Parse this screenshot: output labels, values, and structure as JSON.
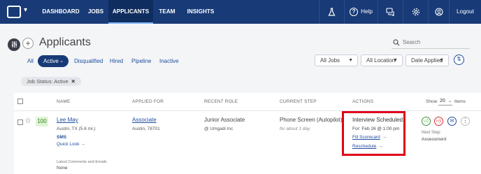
{
  "nav": {
    "items": [
      "DASHBOARD",
      "JOBS",
      "APPLICANTS",
      "TEAM",
      "INSIGHTS"
    ],
    "help_label": "Help",
    "logout_label": "Logout",
    "caret": "▾"
  },
  "page": {
    "title": "Applicants",
    "search_placeholder": "Search"
  },
  "tabs": [
    "All",
    "Active",
    "Disqualified",
    "Hired",
    "Pipeline",
    "Inactive"
  ],
  "filters": {
    "jobs": "All Jobs",
    "location": "All Location",
    "date": "Date Applied"
  },
  "chip": {
    "label": "Job Status: Active",
    "close": "✕"
  },
  "table": {
    "headers": {
      "name": "NAME",
      "applied_for": "APPLIED FOR",
      "recent_role": "RECENT ROLE",
      "current_step": "CURRENT STEP",
      "actions": "ACTIONS",
      "show": "Show",
      "show_value": "20",
      "items": "Items"
    },
    "row": {
      "score": "100",
      "name": "Lee May",
      "location": "Austin, TX (5.6 mi.)",
      "sms": "SMS",
      "quick_look": "Quick Look →",
      "applied_job": "Associate",
      "applied_loc": "Austin, 78701",
      "role": "Junior Associate",
      "company": "@ Umgadi Inc",
      "step": "Phone Screen (Autopilot)",
      "step_duration": "for about 1 day",
      "action_title": "Interview Scheduled",
      "action_date": "For: Feb 26 @ 1:00 pm",
      "fill_scorecard": "Fill Scorecard",
      "reschedule": "Reschedule",
      "next_step_label": "Next Step:",
      "next_step": "Assessment",
      "comments_label": "Latest Comments and Emails",
      "comments_value": "None"
    }
  },
  "colors": {
    "nav_bg": "#183b77",
    "accent": "#1f4d9c",
    "highlight": "#e0001a",
    "score_bg": "#dff5d7"
  }
}
